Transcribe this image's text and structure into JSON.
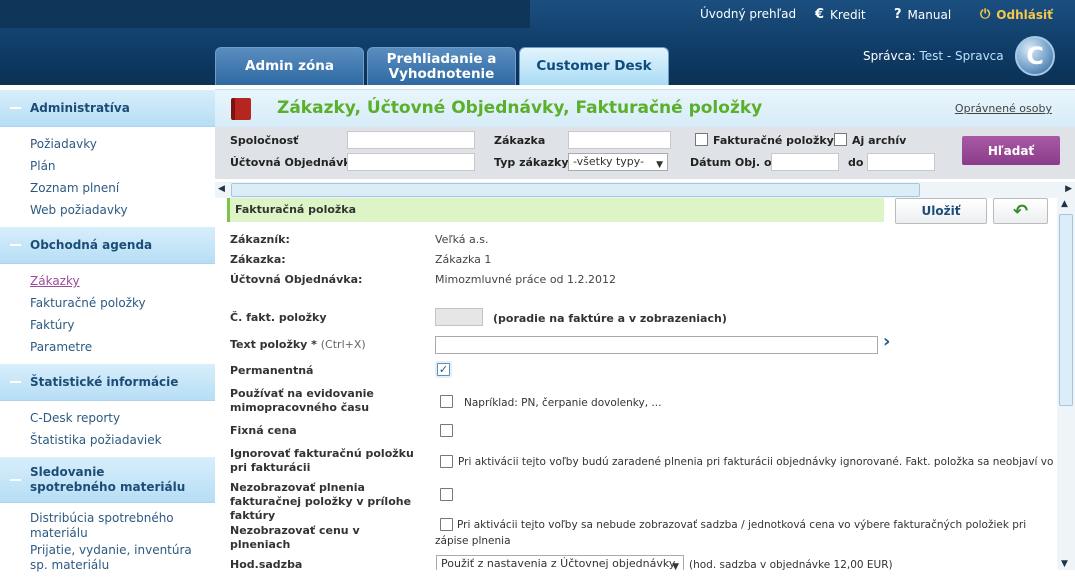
{
  "top": {
    "home": "Úvodný prehľad",
    "credit": "Kredit",
    "manual": "Manual",
    "logout": "Odhlásiť",
    "credit_icon": "€",
    "manual_icon": "?",
    "logout_icon": "⏻"
  },
  "tabs": [
    {
      "label": "Admin zóna"
    },
    {
      "label": "Prehliadanie a Vyhodnotenie"
    },
    {
      "label": "Customer Desk"
    }
  ],
  "user": {
    "prefix": "Správca:",
    "name": "Test - Spravca"
  },
  "logo_letter": "C",
  "sidebar": [
    {
      "title": "Administratíva",
      "items": [
        "Požiadavky",
        "Plán",
        "Zoznam plnení",
        "Web požiadavky"
      ]
    },
    {
      "title": "Obchodná agenda",
      "items": [
        "Zákazky",
        "Fakturačné položky",
        "Faktúry",
        "Parametre"
      ]
    },
    {
      "title": "Štatistické informácie",
      "items": [
        "C-Desk reporty",
        "Štatistika požiadaviek"
      ]
    },
    {
      "title": "Sledovanie spotrebného materiálu",
      "items": [
        "Distribúcia spotrebného materiálu",
        "Prijatie, vydanie, inventúra sp. materiálu"
      ]
    }
  ],
  "page": {
    "title": "Zákazky, Účtovné Objednávky, Fakturačné položky",
    "authorized": "Oprávnené osoby"
  },
  "filter": {
    "spolocnost": "Spoločnosť",
    "uctovna": "Účtovná Objednávka",
    "zakazka": "Zákazka",
    "typ": "Typ zákazky",
    "typ_value": "-všetky typy-",
    "fakt_polozky": "Fakturačné položky",
    "archiv": "Aj archív",
    "datum_od": "Dátum Obj. od",
    "do": "do",
    "search": "Hľadať"
  },
  "form": {
    "section": "Fakturačná položka",
    "save": "Uložiť",
    "zakaznik_l": "Zákazník:",
    "zakaznik_v": "Veľká a.s.",
    "zakazka_l": "Zákazka:",
    "zakazka_v": "Zákazka 1",
    "ucto_l": "Účtovná Objednávka:",
    "ucto_v": "Mimozmluvné práce od 1.2.2012",
    "cislo_l": "Č. fakt. položky",
    "cislo_hint": "(poradie na faktúre a v zobrazeniach)",
    "text_l": "Text položky *",
    "text_hint": "(Ctrl+X)",
    "perm_l": "Permanentná",
    "perm_checked": true,
    "mimo_l": "Používať na evidovanie mimopracovného času",
    "mimo_note": "Napríklad: PN, čerpanie dovolenky, ...",
    "fixna_l": "Fixná cena",
    "ignor_l": "Ignorovať fakturačnú položku pri fakturácii",
    "ignor_note": "Pri aktivácii tejto voľby budú zaradené plnenia pri fakturácii objednávky ignorované. Fakt. položka sa neobjaví vo faktúre.",
    "nezobr_l": "Nezobrazovať plnenia fakturačnej položky v prílohe faktúry",
    "cena_l": "Nezobrazovať cenu v plneniach",
    "cena_note": "Pri aktivácii tejto voľby sa nebude zobrazovať sadzba / jednotková cena vo výbere fakturačných položiek pri zápise plnenia",
    "sadzba_l": "Hod.sadzba",
    "sadzba_value": "Použiť z nastavenia z Účtovnej objednávky",
    "sadzba_note": "(hod. sadzba v objednávke 12,00 EUR)"
  }
}
